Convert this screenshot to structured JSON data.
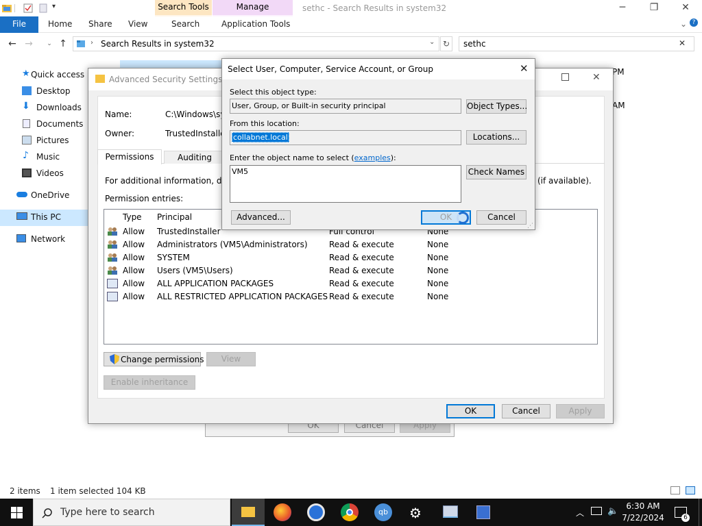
{
  "explorer": {
    "title": "sethc - Search Results in system32",
    "context_tabs": {
      "search_tools": "Search Tools",
      "manage": "Manage",
      "search": "Search",
      "application_tools": "Application Tools"
    },
    "ribbon_tabs": {
      "file": "File",
      "home": "Home",
      "share": "Share",
      "view": "View"
    },
    "address": "Search Results in system32",
    "search_value": "sethc",
    "nav": {
      "quick_access": "Quick access",
      "desktop": "Desktop",
      "downloads": "Downloads",
      "documents": "Documents",
      "pictures": "Pictures",
      "music": "Music",
      "videos": "Videos",
      "onedrive": "OneDrive",
      "this_pc": "This PC",
      "network": "Network"
    },
    "right_times": {
      "t1": "PM",
      "t2": "AM"
    },
    "status": {
      "items": "2 items",
      "selected": "1 item selected  104 KB"
    }
  },
  "advanced_security": {
    "title": "Advanced Security Settings for",
    "name_label": "Name:",
    "name_value": "C:\\Windows\\sys",
    "owner_label": "Owner:",
    "owner_value": "TrustedInstaller",
    "tabs": {
      "permissions": "Permissions",
      "auditing": "Auditing"
    },
    "info_text": "For additional information, doub",
    "info_text_end": "(if available).",
    "entries_label": "Permission entries:",
    "columns": {
      "type": "Type",
      "principal": "Principal"
    },
    "entries": [
      {
        "type": "Allow",
        "principal": "TrustedInstaller",
        "access": "Full control",
        "inherited": "None",
        "icon": "group"
      },
      {
        "type": "Allow",
        "principal": "Administrators (VM5\\Administrators)",
        "access": "Read & execute",
        "inherited": "None",
        "icon": "group"
      },
      {
        "type": "Allow",
        "principal": "SYSTEM",
        "access": "Read & execute",
        "inherited": "None",
        "icon": "group"
      },
      {
        "type": "Allow",
        "principal": "Users (VM5\\Users)",
        "access": "Read & execute",
        "inherited": "None",
        "icon": "group"
      },
      {
        "type": "Allow",
        "principal": "ALL APPLICATION PACKAGES",
        "access": "Read & execute",
        "inherited": "None",
        "icon": "package"
      },
      {
        "type": "Allow",
        "principal": "ALL RESTRICTED APPLICATION PACKAGES",
        "access": "Read & execute",
        "inherited": "None",
        "icon": "package"
      }
    ],
    "buttons": {
      "change_permissions": "Change permissions",
      "view": "View",
      "enable_inheritance": "Enable inheritance",
      "ok": "OK",
      "cancel": "Cancel",
      "apply": "Apply"
    }
  },
  "ghost_dialog": {
    "ok": "OK",
    "cancel": "Cancel",
    "apply": "Apply"
  },
  "select_user": {
    "title": "Select User, Computer, Service Account, or Group",
    "object_type_label": "Select this object type:",
    "object_type_value": "User, Group, or Built-in security principal",
    "object_types_button": "Object Types...",
    "location_label": "From this location:",
    "location_value": "collabnet.local",
    "locations_button": "Locations...",
    "enter_label_pre": "Enter the object name to select (",
    "examples_link": "examples",
    "enter_label_post": "):",
    "object_name_value": "VM5",
    "check_names_button": "Check Names",
    "advanced_button": "Advanced...",
    "ok_button": "OK",
    "cancel_button": "Cancel"
  },
  "taskbar": {
    "search_placeholder": "Type here to search",
    "time": "6:30 AM",
    "date": "7/22/2024",
    "notification_count": "6"
  },
  "colors": {
    "accent": "#0078d7",
    "file_tab": "#1a6fc4",
    "selection": "#cce8ff",
    "taskbar": "#101010"
  }
}
